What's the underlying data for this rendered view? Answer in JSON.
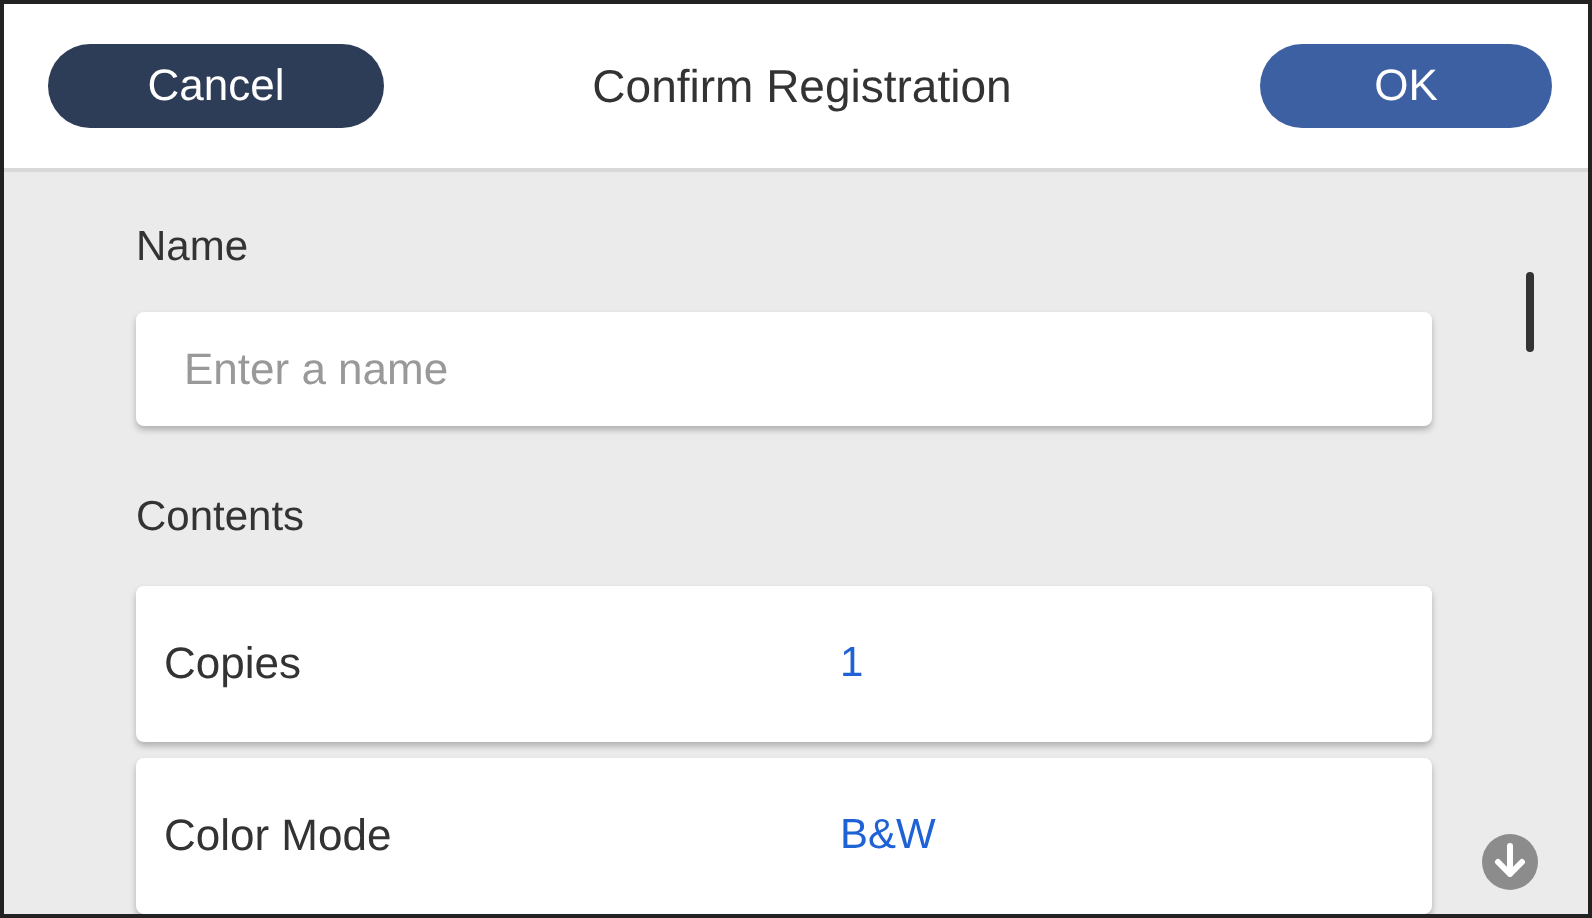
{
  "header": {
    "cancel": "Cancel",
    "title": "Confirm Registration",
    "ok": "OK"
  },
  "name_section": {
    "label": "Name",
    "placeholder": "Enter a name"
  },
  "contents_section": {
    "label": "Contents",
    "rows": [
      {
        "label": "Copies",
        "value": "1"
      },
      {
        "label": "Color Mode",
        "value": "B&W"
      }
    ]
  }
}
